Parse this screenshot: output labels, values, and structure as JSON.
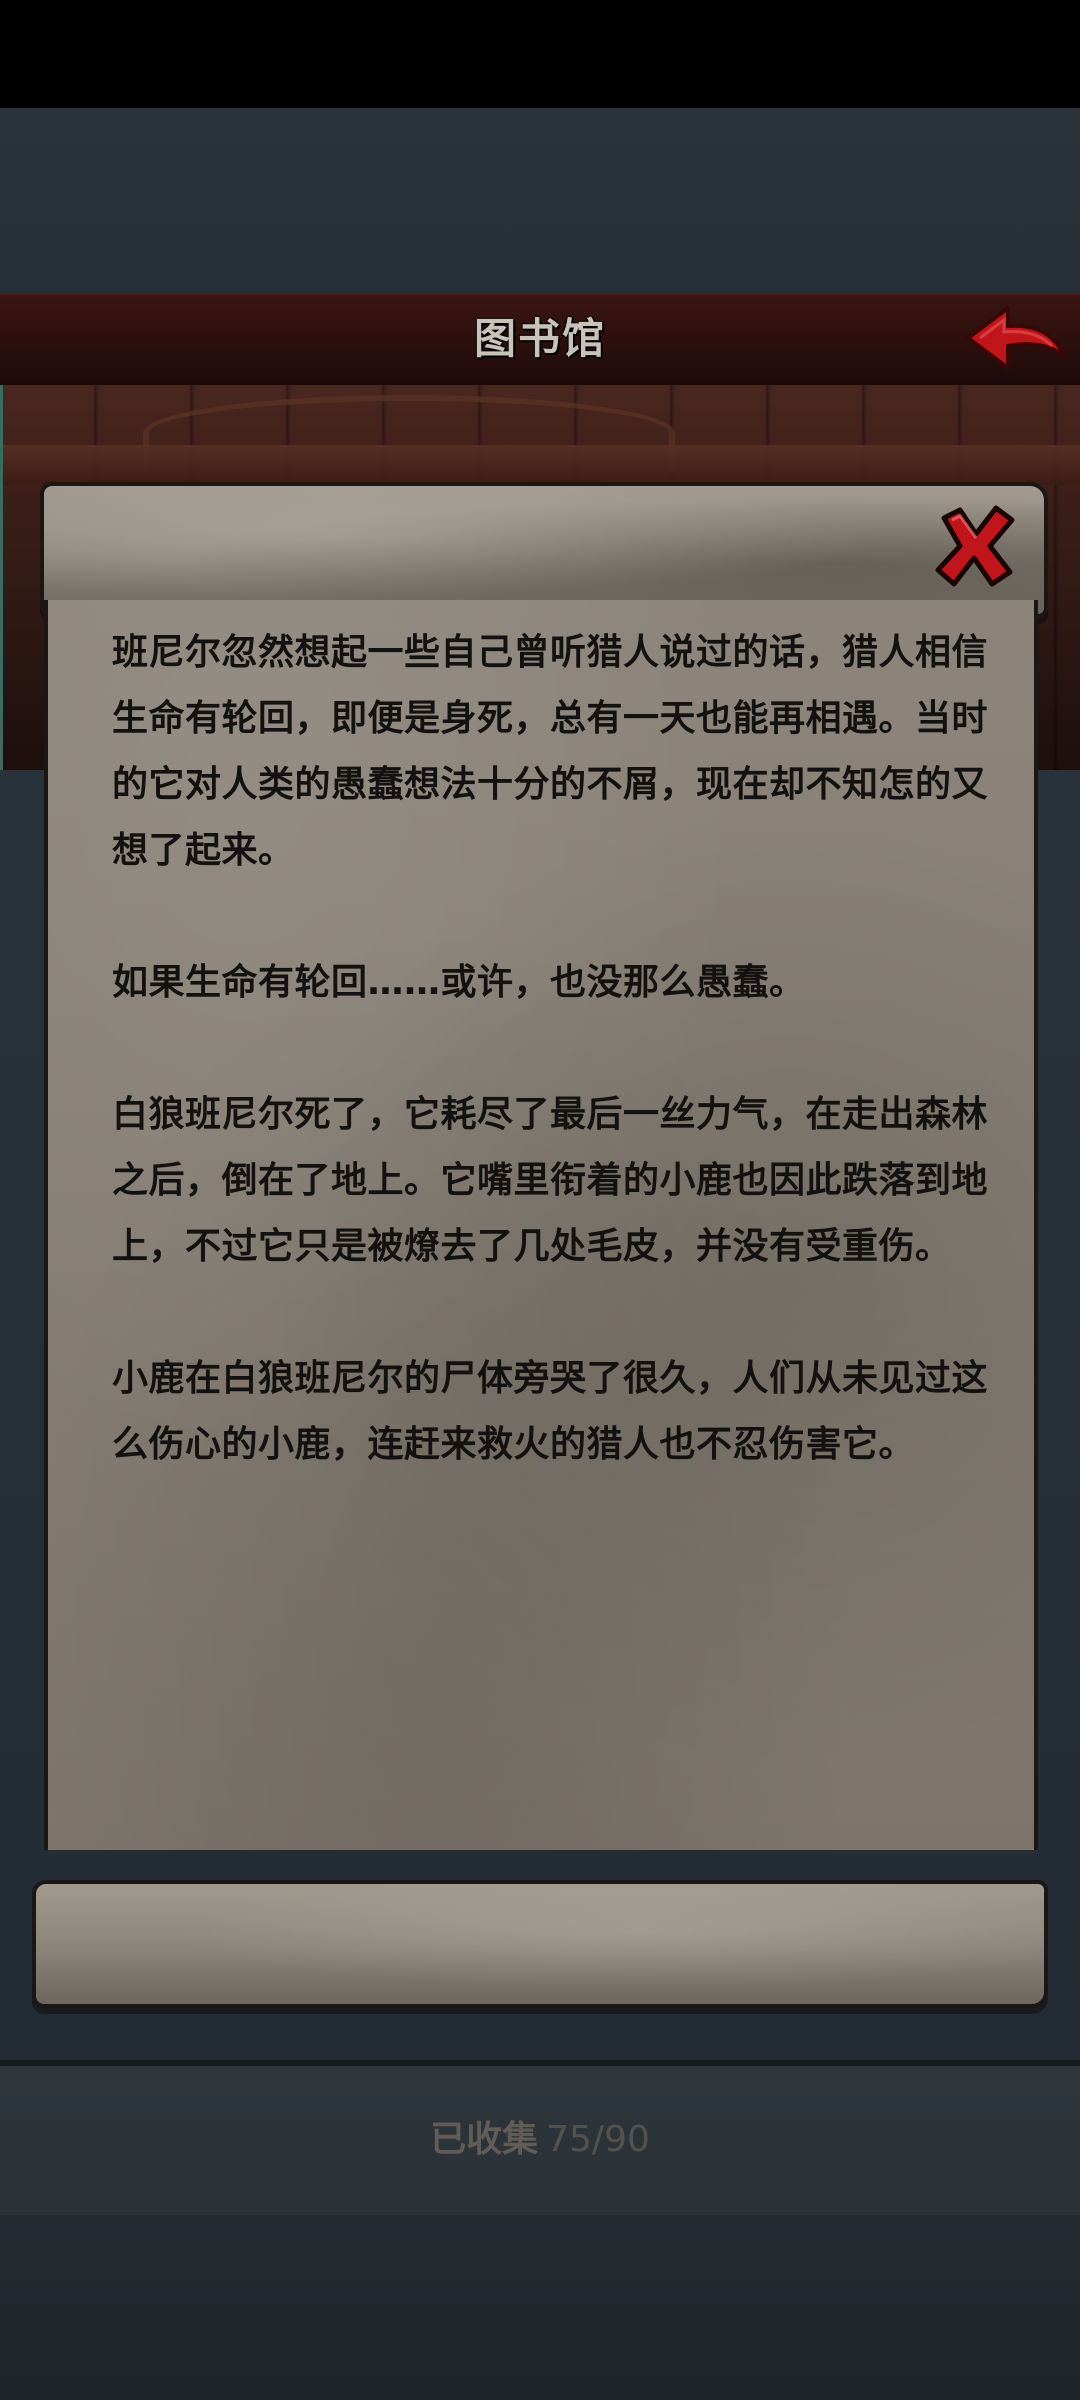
{
  "header": {
    "title": "图书馆",
    "back_icon": "back-arrow-icon"
  },
  "dialog": {
    "close_icon": "close-x-icon",
    "paragraphs": [
      "班尼尔忽然想起一些自己曾听猎人说过的话，猎人相信生命有轮回，即便是身死，总有一天也能再相遇。当时的它对人类的愚蠢想法十分的不屑，现在却不知怎的又想了起来。",
      "如果生命有轮回……或许，也没那么愚蠢。",
      "白狼班尼尔死了，它耗尽了最后一丝力气，在走出森林之后，倒在了地上。它嘴里衔着的小鹿也因此跌落到地上，不过它只是被燎去了几处毛皮，并没有受重伤。",
      "小鹿在白狼班尼尔的尸体旁哭了很久，人们从未见过这么伤心的小鹿，连赶来救火的猎人也不忍伤害它。"
    ]
  },
  "footer": {
    "collected_label": "已收集",
    "collected_count": "75/90"
  },
  "colors": {
    "title_bar": "#2a0f0d",
    "parchment": "#8a8278",
    "accent_red": "#c0151b",
    "text_dark": "#141210"
  }
}
